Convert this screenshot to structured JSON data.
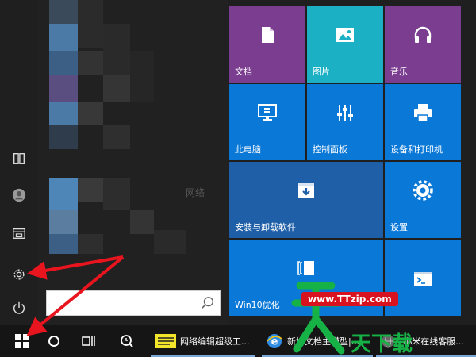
{
  "colors": {
    "tile_purple": "#7a3d8f",
    "tile_teal": "#1cb0c4",
    "tile_blue": "#0a78d7",
    "tile_dark_blue": "#1f5fa8",
    "taskbar": "#151515",
    "arrow": "#e8141e",
    "watermark_green": "#17b245"
  },
  "rail": {
    "items": [
      {
        "name": "tablet-mode-icon"
      },
      {
        "name": "user-icon"
      },
      {
        "name": "file-explorer-icon"
      },
      {
        "name": "settings-icon"
      },
      {
        "name": "power-icon"
      }
    ]
  },
  "applist": {
    "ghost_text": "网络",
    "search_placeholder": ""
  },
  "tiles": [
    {
      "id": "documents",
      "label": "文档",
      "icon": "document-icon",
      "color": "#7a3d8f"
    },
    {
      "id": "pictures",
      "label": "图片",
      "icon": "picture-icon",
      "color": "#1cb0c4"
    },
    {
      "id": "music",
      "label": "音乐",
      "icon": "headphones-icon",
      "color": "#7a3d8f"
    },
    {
      "id": "this-pc",
      "label": "此电脑",
      "icon": "monitor-icon",
      "color": "#0a78d7"
    },
    {
      "id": "control-panel",
      "label": "控制面板",
      "icon": "sliders-icon",
      "color": "#0a78d7"
    },
    {
      "id": "devices-printers",
      "label": "设备和打印机",
      "icon": "printer-icon",
      "color": "#0a78d7"
    },
    {
      "id": "programs-features",
      "label": "安装与卸载软件",
      "icon": "install-box-icon",
      "color": "#1f5fa8"
    },
    {
      "id": "settings",
      "label": "设置",
      "icon": "gear-icon",
      "color": "#0a78d7"
    },
    {
      "id": "win10-optimize",
      "label": "Win10优化",
      "icon": "window-bracket-icon",
      "color": "#0a78d7"
    },
    {
      "id": "console",
      "label": "",
      "icon": "terminal-icon",
      "color": "#0a78d7"
    }
  ],
  "taskbar": {
    "apps": [
      {
        "label": "网络编辑超级工...",
        "icon": "notepad-icon"
      },
      {
        "label": "新增文档主模型|...",
        "icon": "browser-e-icon"
      },
      {
        "label": "[小米在线客服...",
        "icon": "globe-icon"
      }
    ]
  },
  "watermark": {
    "url": "www.TTzip.com",
    "logo_text": "天天下载"
  }
}
